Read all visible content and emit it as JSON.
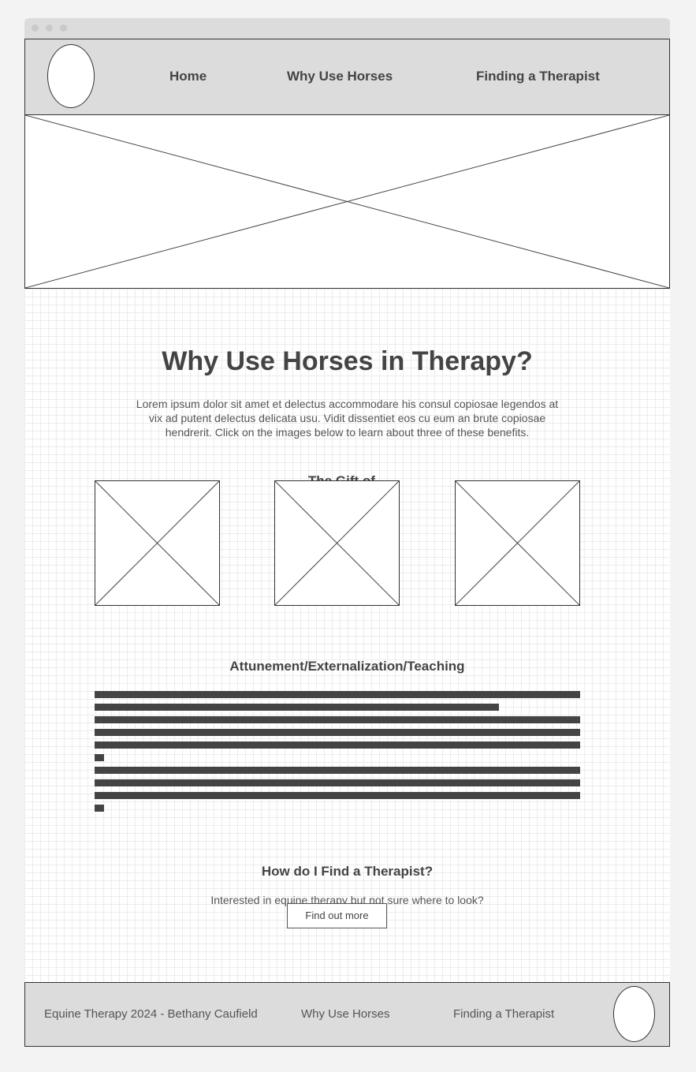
{
  "nav": {
    "home": "Home",
    "why": "Why Use Horses",
    "finding": "Finding a Therapist"
  },
  "main": {
    "title": "Why Use Horses in Therapy?",
    "intro_lines": [
      "Lorem ipsum dolor sit amet et delectus accommodare his consul copiosae legendos at",
      "vix ad putent delectus delicata usu. Vidit dissentiet eos cu eum an brute copiosae",
      "hendrerit. Click on the images below to learn about three of these benefits."
    ],
    "gift_heading": "The Gift of...",
    "benefit_heading": "Attunement/Externalization/Teaching",
    "therapist_heading": "How do I Find a Therapist?",
    "therapist_text": "Interested in equine therapy but not sure where to look?",
    "cta": "Find out more"
  },
  "footer": {
    "copyright": "Equine Therapy 2024 - Bethany Caufield",
    "why": "Why Use Horses",
    "finding": "Finding a Therapist"
  }
}
